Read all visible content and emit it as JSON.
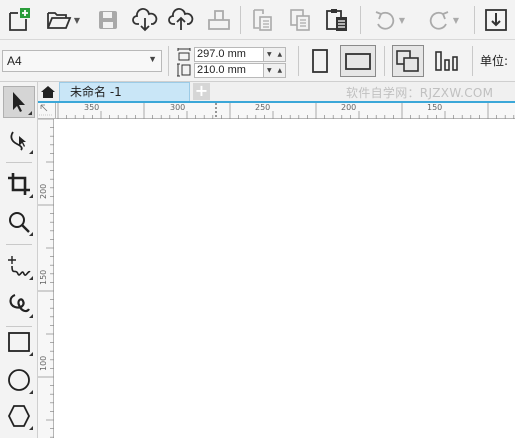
{
  "toolbar": {
    "buttons": [
      {
        "name": "new-document-button",
        "icon": "new-doc-icon"
      },
      {
        "name": "open-button",
        "icon": "folder-icon"
      },
      {
        "name": "save-button",
        "icon": "save-icon"
      },
      {
        "name": "import-button",
        "icon": "cloud-download-icon"
      },
      {
        "name": "export-button",
        "icon": "cloud-upload-icon"
      },
      {
        "name": "print-button",
        "icon": "print-icon"
      },
      {
        "name": "cut-button",
        "icon": "cut-icon"
      },
      {
        "name": "copy-button",
        "icon": "copy-icon"
      },
      {
        "name": "paste-button",
        "icon": "paste-icon"
      },
      {
        "name": "undo-button",
        "icon": "undo-icon"
      },
      {
        "name": "redo-button",
        "icon": "redo-icon"
      },
      {
        "name": "import-arrow-button",
        "icon": "import-arrow-icon"
      }
    ]
  },
  "property_bar": {
    "page_size": "A4",
    "width_value": "297.0 mm",
    "height_value": "210.0 mm",
    "unit_label": "单位:"
  },
  "tabs": {
    "document_tab": "未命名 -1",
    "add_tab": "+"
  },
  "watermark": "软件自学网：RJZXW.COM",
  "ruler": {
    "horizontal_labels": [
      "350",
      "300",
      "250",
      "200",
      "150"
    ],
    "vertical_labels": [
      "200",
      "150",
      "100"
    ]
  },
  "toolbox": [
    {
      "name": "pick-tool",
      "icon": "pointer-icon",
      "active": true
    },
    {
      "name": "shape-tool",
      "icon": "shape-edit-icon"
    },
    {
      "name": "crop-tool",
      "icon": "crop-icon"
    },
    {
      "name": "zoom-tool",
      "icon": "magnifier-icon"
    },
    {
      "name": "freehand-tool",
      "icon": "freehand-icon"
    },
    {
      "name": "artistic-media-tool",
      "icon": "artistic-media-icon"
    },
    {
      "name": "rectangle-tool",
      "icon": "rectangle-icon"
    },
    {
      "name": "ellipse-tool",
      "icon": "ellipse-icon"
    },
    {
      "name": "polygon-tool",
      "icon": "hexagon-icon"
    }
  ],
  "colors": {
    "tab_active": "#c9e6f7",
    "tab_underline": "#3ba7d8",
    "toolbar_bg": "#f3f3f3",
    "new_doc_accent": "#2a9d3a"
  }
}
